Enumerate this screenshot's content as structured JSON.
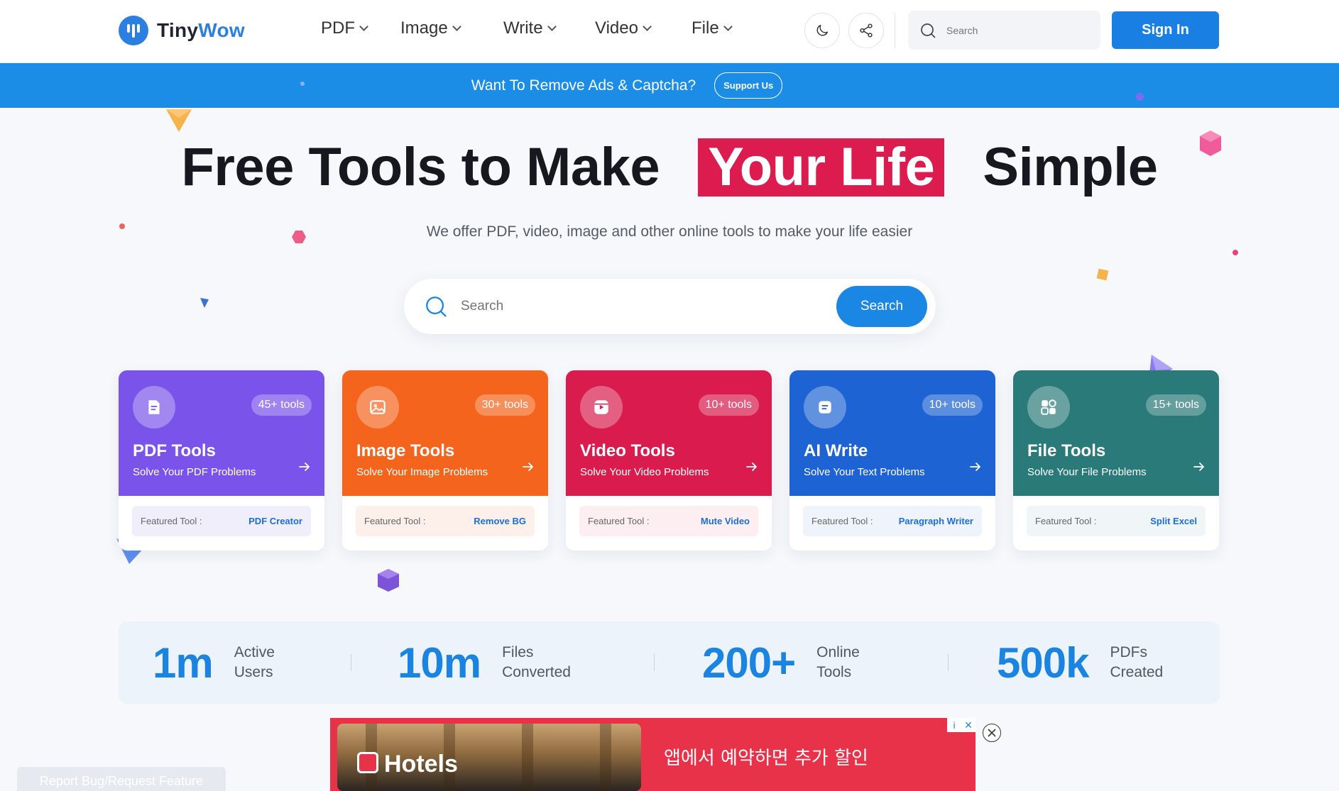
{
  "header": {
    "logo": {
      "part1": "Tiny",
      "part2": "Wow"
    },
    "nav": [
      {
        "label": "PDF"
      },
      {
        "label": "Image"
      },
      {
        "label": "Write"
      },
      {
        "label": "Video"
      },
      {
        "label": "File"
      }
    ],
    "search_placeholder": "Search",
    "signin_label": "Sign In"
  },
  "banner": {
    "text": "Want To Remove Ads & Captcha?",
    "button": "Support Us"
  },
  "hero": {
    "title_part1": "Free Tools to Make",
    "title_highlight": "Your Life",
    "title_part2": "Simple",
    "subtitle": "We offer PDF, video, image and other online tools to make your life easier",
    "search_placeholder": "Search",
    "search_button": "Search"
  },
  "cards": [
    {
      "title": "PDF Tools",
      "subtitle": "Solve Your PDF Problems",
      "badge": "45+ tools",
      "featured_label": "Featured Tool :",
      "featured_value": "PDF Creator",
      "color": "#7a54ea",
      "foot_bg": "#f1eefc",
      "icon": "pdf-icon"
    },
    {
      "title": "Image Tools",
      "subtitle": "Solve Your Image Problems",
      "badge": "30+ tools",
      "featured_label": "Featured Tool :",
      "featured_value": "Remove BG",
      "color": "#f4641c",
      "foot_bg": "#fdf0ea",
      "icon": "image-icon"
    },
    {
      "title": "Video Tools",
      "subtitle": "Solve Your Video Problems",
      "badge": "10+ tools",
      "featured_label": "Featured Tool :",
      "featured_value": "Mute Video",
      "color": "#d91c4d",
      "foot_bg": "#fceef1",
      "icon": "video-icon"
    },
    {
      "title": "AI Write",
      "subtitle": "Solve Your Text Problems",
      "badge": "10+ tools",
      "featured_label": "Featured Tool :",
      "featured_value": "Paragraph Writer",
      "color": "#1e63d3",
      "foot_bg": "#eef3fc",
      "icon": "write-icon"
    },
    {
      "title": "File Tools",
      "subtitle": "Solve Your File Problems",
      "badge": "15+ tools",
      "featured_label": "Featured Tool :",
      "featured_value": "Split Excel",
      "color": "#297a78",
      "foot_bg": "#f0f5f8",
      "icon": "file-icon"
    }
  ],
  "stats": [
    {
      "value": "1m",
      "label_line1": "Active",
      "label_line2": "Users"
    },
    {
      "value": "10m",
      "label_line1": "Files",
      "label_line2": "Converted"
    },
    {
      "value": "200+",
      "label_line1": "Online",
      "label_line2": "Tools"
    },
    {
      "value": "500k",
      "label_line1": "PDFs",
      "label_line2": "Created"
    }
  ],
  "ad": {
    "brand": "Hotels",
    "text": "앱에서 예약하면 추가 할인",
    "info": "i",
    "x": "✕"
  },
  "report_label": "Report Bug/Request Feature",
  "colors": {
    "primary": "#1a84e0",
    "banner": "#1b8de6",
    "highlight": "#dc1b4e"
  }
}
